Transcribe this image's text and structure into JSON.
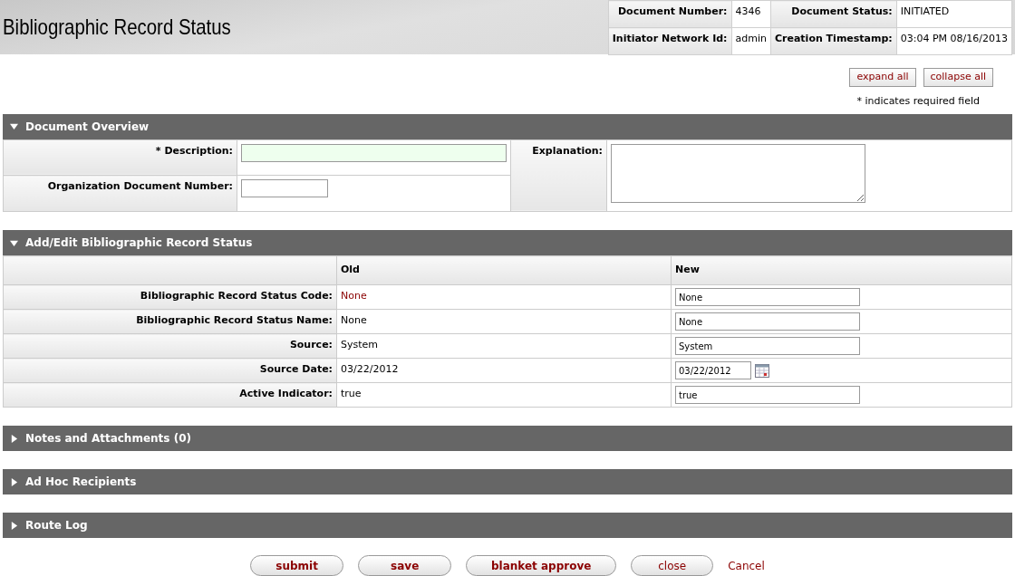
{
  "header": {
    "title": "Bibliographic Record Status",
    "info": [
      {
        "label": "Document Number:",
        "value": "4346"
      },
      {
        "label": "Document Status:",
        "value": "INITIATED"
      },
      {
        "label": "Initiator Network Id:",
        "value": "admin"
      },
      {
        "label": "Creation Timestamp:",
        "value": "03:04 PM 08/16/2013"
      }
    ]
  },
  "top_buttons": [
    "expand all",
    "collapse all"
  ],
  "required_note": "* indicates required field",
  "overview": {
    "title": "Document Overview",
    "expanded": true,
    "description": {
      "label": "* Description:"
    },
    "org_doc_number": {
      "label": "Organization Document Number:"
    },
    "explanation": {
      "label": "Explanation:"
    }
  },
  "edit": {
    "title": "Add/Edit Bibliographic Record Status",
    "expanded": true,
    "columns": [
      "Old",
      "New"
    ],
    "rows": [
      {
        "label": "Bibliographic Record Status Code:",
        "old": "None",
        "changed": true,
        "new": "None",
        "kind": "text"
      },
      {
        "label": "Bibliographic Record Status Name:",
        "old": "None",
        "changed": false,
        "new": "None",
        "kind": "text"
      },
      {
        "label": "Source:",
        "old": "System",
        "changed": false,
        "new": "System",
        "kind": "text"
      },
      {
        "label": "Source Date:",
        "old": "03/22/2012",
        "changed": false,
        "new": "03/22/2012",
        "kind": "date"
      },
      {
        "label": "Active Indicator:",
        "old": "true",
        "changed": false,
        "new": "true",
        "kind": "text"
      }
    ]
  },
  "collapsed_sections": [
    {
      "title": "Notes and Attachments (0)",
      "expanded": false
    },
    {
      "title": "Ad Hoc Recipients",
      "expanded": false
    },
    {
      "title": "Route Log",
      "expanded": false
    }
  ],
  "actions": [
    {
      "label": "submit",
      "kind": "primary"
    },
    {
      "label": "save",
      "kind": "primary"
    },
    {
      "label": "blanket approve",
      "kind": "primary"
    },
    {
      "label": "close",
      "kind": "secondary"
    },
    {
      "label": "Cancel",
      "kind": "link"
    }
  ]
}
